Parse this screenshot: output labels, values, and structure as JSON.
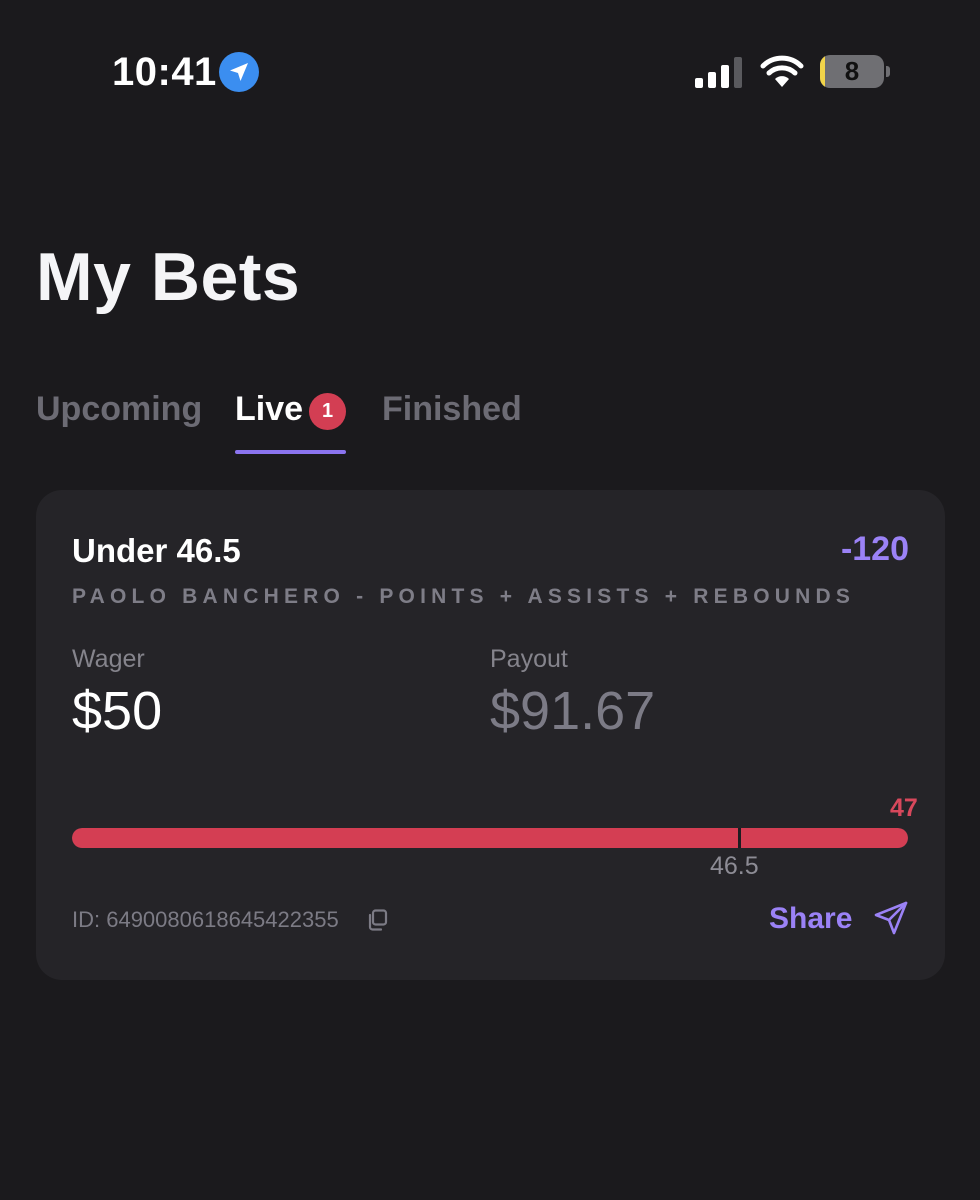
{
  "status_bar": {
    "time": "10:41",
    "battery_level": "8",
    "battery_fraction": 0.08
  },
  "page": {
    "title": "My Bets"
  },
  "tabs": [
    {
      "label": "Upcoming",
      "active": false
    },
    {
      "label": "Live",
      "active": true,
      "badge": "1"
    },
    {
      "label": "Finished",
      "active": false
    }
  ],
  "bet": {
    "line": "Under 46.5",
    "odds": "-120",
    "market": "PAOLO BANCHERO - POINTS + ASSISTS + REBOUNDS",
    "wager_label": "Wager",
    "wager_value": "$50",
    "payout_label": "Payout",
    "payout_value": "$91.67",
    "progress": {
      "line_value": "46.5",
      "current_value": "47",
      "fill_fraction": 1.0
    },
    "id_text": "ID: 6490080618645422355",
    "share_label": "Share"
  },
  "colors": {
    "background": "#1b1a1d",
    "card": "#252428",
    "accent_purple": "#9b82f6",
    "tab_underline": "#8b74ef",
    "status_red": "#d43e53",
    "location_blue": "#3b8ef0",
    "battery_yellow": "#f1d44a"
  },
  "icons": {
    "location": "location-arrow-icon",
    "signal": "cellular-signal-icon",
    "wifi": "wifi-icon",
    "copy": "copy-icon",
    "send": "send-icon"
  }
}
